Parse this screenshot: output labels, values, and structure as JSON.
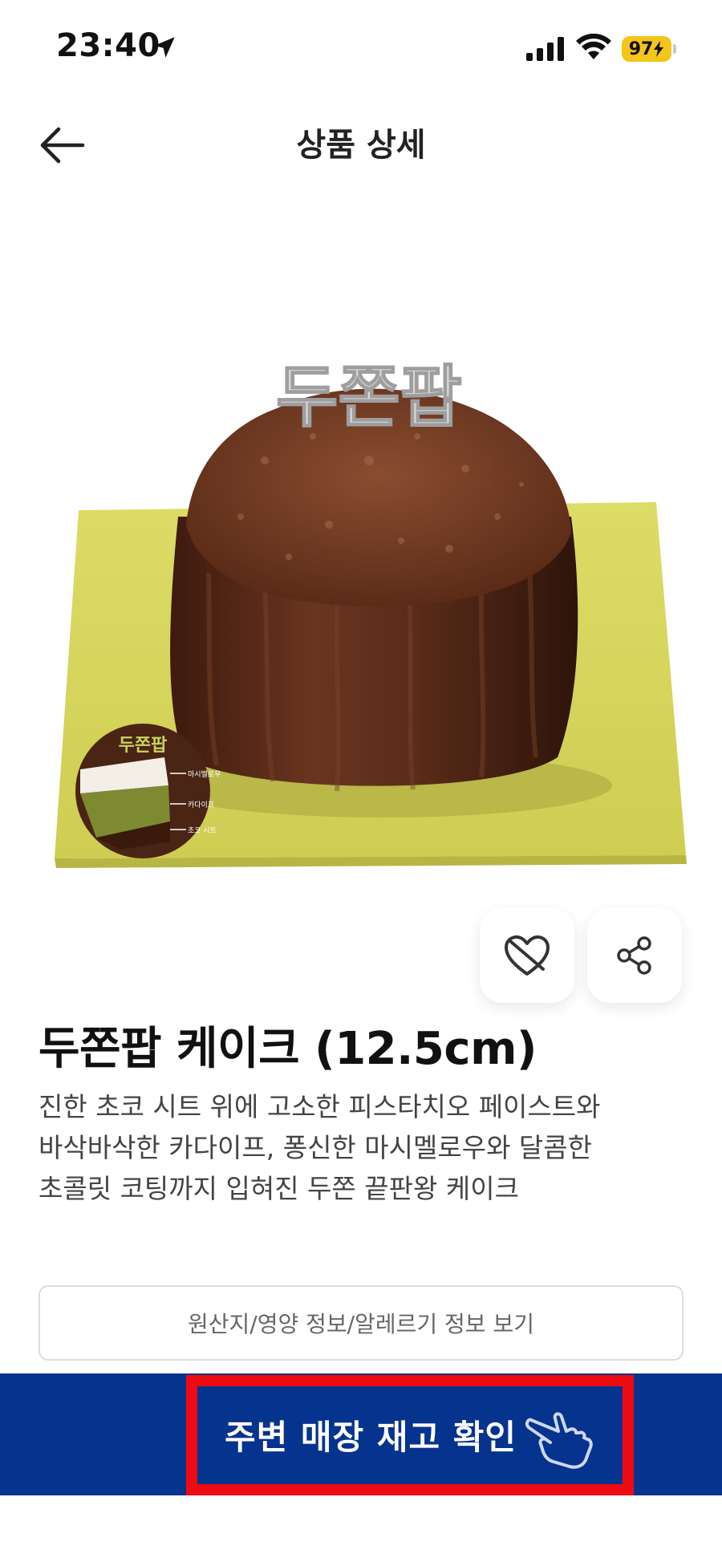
{
  "status_bar": {
    "time": "23:40",
    "battery": "97",
    "battery_color": "#f4c51a"
  },
  "header": {
    "title": "상품 상세",
    "back_icon": "arrow-left-icon"
  },
  "product_image": {
    "overlay_title": "두쫀팝",
    "inset_title": "두쫀팝",
    "inset_labels": [
      "마시멜로우",
      "카다이프",
      "초코 시트"
    ],
    "board_color": "#d6d55a",
    "cake_color": "#5a2a18"
  },
  "actions": {
    "wish_icon": "heart-outline-icon",
    "share_icon": "share-icon"
  },
  "product": {
    "name": "두쫀팝 케이크 (12.5cm)",
    "description_lines": [
      "진한 초코 시트 위에 고소한 피스타치오 페이스트와",
      "바삭바삭한 카다이프, 퐁신한 마시멜로우와 달콤한",
      "초콜릿 코팅까지 입혀진 두쫀 끝판왕 케이크"
    ]
  },
  "info_button": {
    "label": "원산지/영양 정보/알레르기 정보 보기"
  },
  "bottom_bar": {
    "stock_label": "주변 매장 재고 확인",
    "hand_icon": "pointing-hand-icon",
    "bar_color": "#06338e",
    "highlight_color": "#ee0b12"
  }
}
